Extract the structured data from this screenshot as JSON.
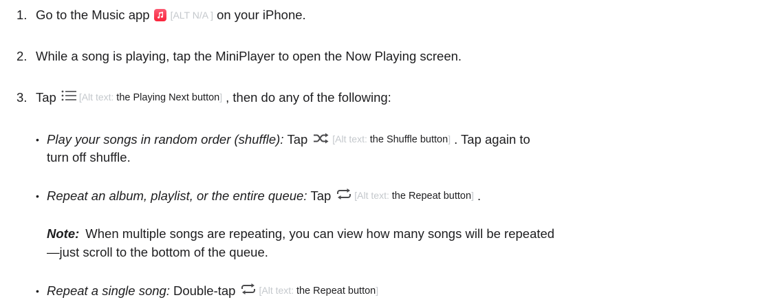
{
  "steps": [
    {
      "number": "1.",
      "before": "Go to the Music app",
      "icon": "music-app-icon",
      "alt_open": "[ALT N/A ]",
      "after": "on your iPhone."
    },
    {
      "number": "2.",
      "text": "While a song is playing, tap the MiniPlayer to open the Now Playing screen."
    },
    {
      "number": "3.",
      "before": "Tap",
      "icon": "playing-next-icon",
      "alt_prefix": "[Alt text: ",
      "alt_value": "the Playing Next button",
      "alt_suffix": "]",
      "after": ", then do any of the following:"
    }
  ],
  "bullets": [
    {
      "bullet": "•",
      "label": "Play your songs in random order (shuffle):",
      "before": "Tap",
      "icon": "shuffle-icon",
      "alt_prefix": "[Alt text: ",
      "alt_value": "the Shuffle button",
      "alt_suffix": "]",
      "after": ". Tap again to",
      "continuation": "turn off shuffle."
    },
    {
      "bullet": "•",
      "label": "Repeat an album, playlist, or the entire queue:",
      "before": "Tap",
      "icon": "repeat-icon",
      "alt_prefix": "[Alt text: ",
      "alt_value": "the Repeat button",
      "alt_suffix": "]",
      "after": "."
    },
    {
      "bullet": "•",
      "label": "Repeat a single song:",
      "before": "Double-tap",
      "icon": "repeat-icon",
      "alt_prefix": "[Alt text: ",
      "alt_value": "the Repeat button",
      "alt_suffix": "]"
    }
  ],
  "note": {
    "label": "Note:",
    "line1": "When multiple songs are repeating, you can view how many songs will be repeated",
    "line2": "—just scroll to the bottom of the queue."
  },
  "colors": {
    "text": "#1d1d1f",
    "alt_text": "#c4c8cc",
    "music_app": "#fa233b",
    "icon": "#4a4a4c"
  }
}
